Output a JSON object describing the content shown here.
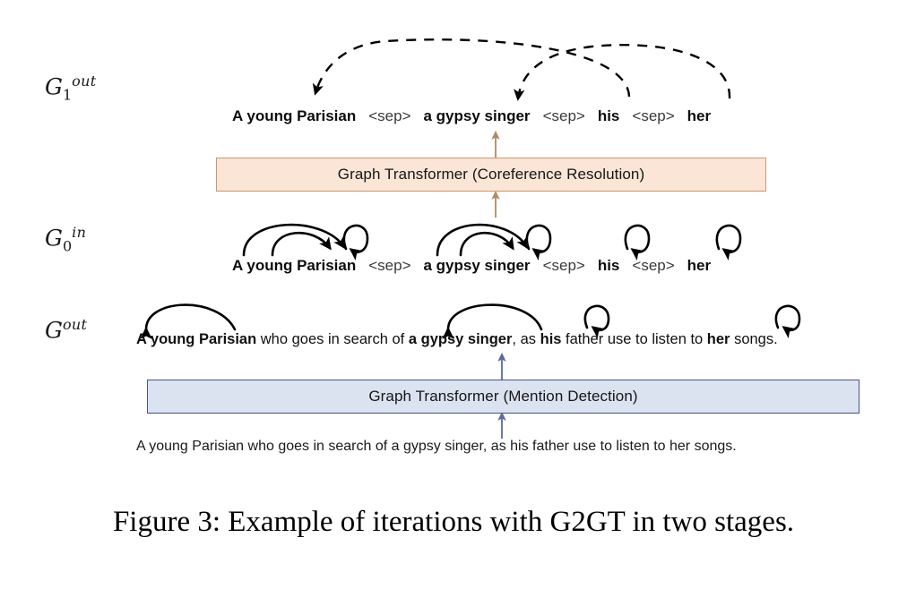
{
  "figure": {
    "caption": "Figure 3: Example of iterations with G2GT in two stages."
  },
  "stages": {
    "g1_out": {
      "symbol": "G",
      "sub": "1",
      "sup": "out"
    },
    "g0_in": {
      "symbol": "G",
      "sub": "0",
      "sup": "in"
    },
    "g_out": {
      "symbol": "G",
      "sub": "",
      "sup": "out"
    }
  },
  "rows": {
    "g1_out_tokens": [
      {
        "text": "A young Parisian",
        "kind": "mention"
      },
      {
        "text": "<sep>",
        "kind": "sep"
      },
      {
        "text": "a gypsy singer",
        "kind": "mention"
      },
      {
        "text": "<sep>",
        "kind": "sep"
      },
      {
        "text": "his",
        "kind": "mention"
      },
      {
        "text": "<sep>",
        "kind": "sep"
      },
      {
        "text": "her",
        "kind": "mention"
      }
    ],
    "g0_in_tokens": [
      {
        "text": "A young Parisian",
        "kind": "mention"
      },
      {
        "text": "<sep>",
        "kind": "sep"
      },
      {
        "text": "a gypsy singer",
        "kind": "mention"
      },
      {
        "text": "<sep>",
        "kind": "sep"
      },
      {
        "text": "his",
        "kind": "mention"
      },
      {
        "text": "<sep>",
        "kind": "sep"
      },
      {
        "text": "her",
        "kind": "mention"
      }
    ],
    "g_out_sentence_parts": [
      {
        "text": "A young Parisian",
        "bold": true
      },
      {
        "text": " who goes in search of ",
        "bold": false
      },
      {
        "text": "a gypsy singer",
        "bold": true
      },
      {
        "text": ", as ",
        "bold": false
      },
      {
        "text": "his",
        "bold": true
      },
      {
        "text": " father use to listen to ",
        "bold": false
      },
      {
        "text": "her",
        "bold": true
      },
      {
        "text": " songs.",
        "bold": false
      }
    ],
    "input_sentence": "A young Parisian who goes in search of a gypsy singer, as his father use to listen to her songs."
  },
  "modules": {
    "coreference": {
      "label": "Graph Transformer (Coreference Resolution)",
      "fill": "#fae5d6",
      "border": "#c8996f",
      "arrow_color": "#b08a64"
    },
    "mention_detection": {
      "label": "Graph Transformer (Mention Detection)",
      "fill": "#dce3f0",
      "border": "#48528c",
      "arrow_color": "#5d6a9e"
    }
  },
  "edges": {
    "coref_dashed": [
      {
        "from": "his",
        "to": "A young Parisian",
        "style": "dashed"
      },
      {
        "from": "her",
        "to": "a gypsy singer",
        "style": "dashed"
      }
    ],
    "g0_in_arcs": [
      {
        "span": "A young Parisian",
        "type": "span-arc"
      },
      {
        "span": "A young Parisian",
        "type": "span-arc-inner"
      },
      {
        "span": "A young Parisian",
        "type": "self-loop"
      },
      {
        "span": "a gypsy singer",
        "type": "span-arc"
      },
      {
        "span": "a gypsy singer",
        "type": "span-arc-inner"
      },
      {
        "span": "a gypsy singer",
        "type": "self-loop"
      },
      {
        "span": "his",
        "type": "self-loop"
      },
      {
        "span": "her",
        "type": "self-loop"
      }
    ],
    "g_out_arcs": [
      {
        "span": "A young Parisian",
        "type": "span-arc"
      },
      {
        "span": "a gypsy singer",
        "type": "span-arc"
      },
      {
        "span": "his",
        "type": "self-loop"
      },
      {
        "span": "her",
        "type": "self-loop"
      }
    ]
  }
}
